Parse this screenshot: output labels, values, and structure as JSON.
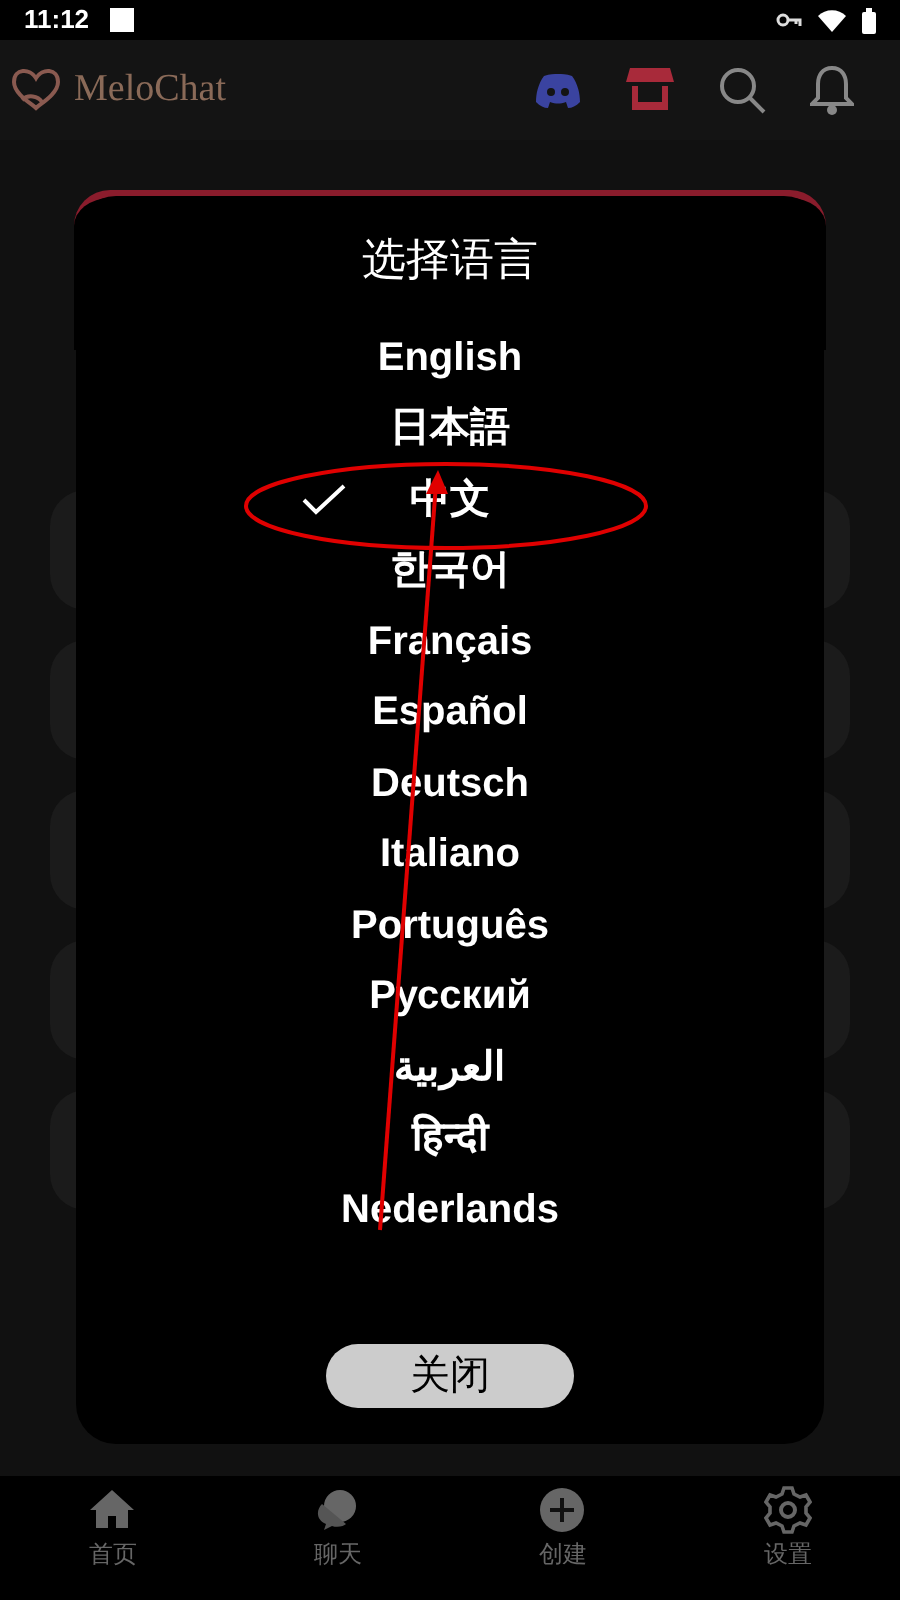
{
  "status_bar": {
    "time": "11:12"
  },
  "app_bar": {
    "title": "MeloChat"
  },
  "dialog": {
    "title": "选择语言",
    "languages": [
      {
        "label": "English",
        "selected": false
      },
      {
        "label": "日本語",
        "selected": false
      },
      {
        "label": "中文",
        "selected": true
      },
      {
        "label": "한국어",
        "selected": false
      },
      {
        "label": "Français",
        "selected": false
      },
      {
        "label": "Español",
        "selected": false
      },
      {
        "label": "Deutsch",
        "selected": false
      },
      {
        "label": "Italiano",
        "selected": false
      },
      {
        "label": "Português",
        "selected": false
      },
      {
        "label": "Русский",
        "selected": false
      },
      {
        "label": "العربية",
        "selected": false
      },
      {
        "label": "हिन्दी",
        "selected": false
      },
      {
        "label": "Nederlands",
        "selected": false
      }
    ],
    "close_button": "关闭"
  },
  "bottom_nav": [
    {
      "kind": "home",
      "label": "首页"
    },
    {
      "kind": "chat",
      "label": "聊天"
    },
    {
      "kind": "create",
      "label": "创建"
    },
    {
      "kind": "settings",
      "label": "设置"
    }
  ]
}
